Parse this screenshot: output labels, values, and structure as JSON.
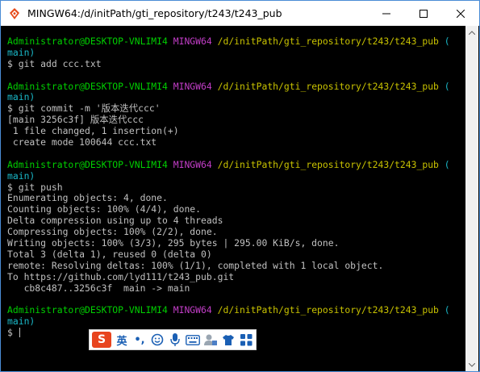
{
  "window": {
    "title": "MINGW64:/d/initPath/gti_repository/t243/t243_pub"
  },
  "terminal": {
    "prompt_user": "Administrator@DESKTOP-VNLIMI4",
    "prompt_env": "MINGW64",
    "prompt_path": "/d/initPath/gti_repository/t243/t243_pub",
    "prompt_branch_open": "(",
    "prompt_branch_close": "main)",
    "blocks": [
      {
        "command": "$ git add ccc.txt",
        "output": []
      },
      {
        "command": "$ git commit -m '版本迭代ccc'",
        "output": [
          "[main 3256c3f] 版本迭代ccc",
          " 1 file changed, 1 insertion(+)",
          " create mode 100644 ccc.txt"
        ]
      },
      {
        "command": "$ git push",
        "output": [
          "Enumerating objects: 4, done.",
          "Counting objects: 100% (4/4), done.",
          "Delta compression using up to 4 threads",
          "Compressing objects: 100% (2/2), done.",
          "Writing objects: 100% (3/3), 295 bytes | 295.00 KiB/s, done.",
          "Total 3 (delta 1), reused 0 (delta 0)",
          "remote: Resolving deltas: 100% (1/1), completed with 1 local object.",
          "To https://github.com/lyd111/t243_pub.git",
          "   cb8c487..3256c3f  main -> main"
        ]
      }
    ],
    "final_prompt": "$ "
  },
  "ime": {
    "logo": "S",
    "language": "英",
    "punctuation": "•,",
    "icons": [
      "emoji-icon",
      "microphone-icon",
      "keyboard-icon",
      "user-icon",
      "shirt-icon",
      "grid-icon"
    ]
  },
  "colors": {
    "user_green": "#00d000",
    "env_magenta": "#c33ec8",
    "path_yellow": "#c8c200",
    "branch_cyan": "#1ab8c8",
    "text_gray": "#c0c0c0",
    "ime_red": "#e8441e"
  }
}
